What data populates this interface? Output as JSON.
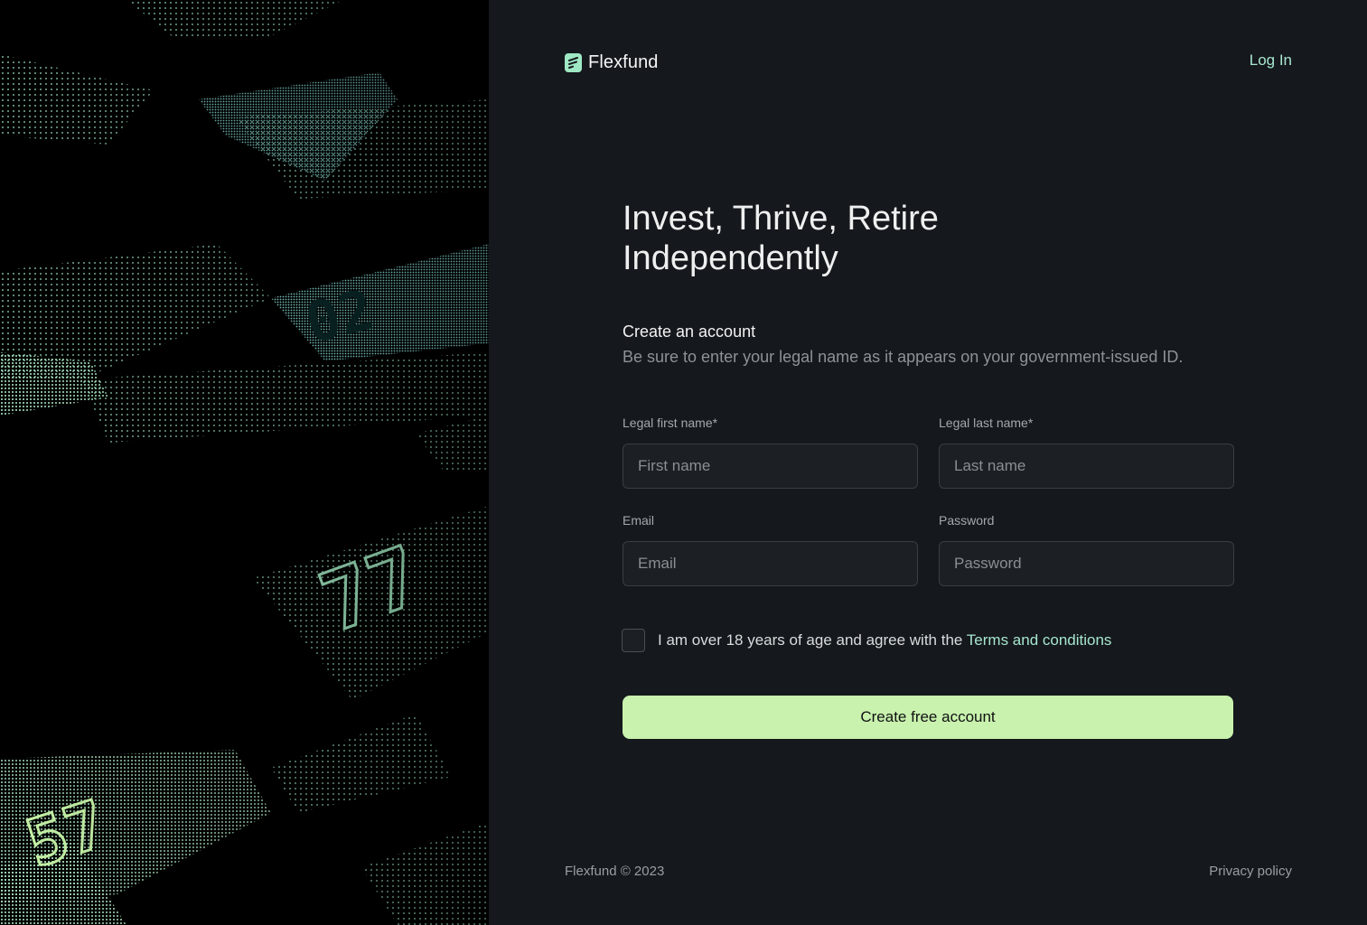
{
  "brand": {
    "name": "Flexfund",
    "accent": "#a6e6cf",
    "button_color": "#c8f2ae",
    "icon": "flexfund-logo-icon"
  },
  "nav": {
    "login_label": "Log In"
  },
  "hero": {
    "headline_line1": "Invest, Thrive, Retire",
    "headline_line2": "Independently"
  },
  "form": {
    "title": "Create an account",
    "subtitle": "Be sure to enter your legal name as it appears on your government-issued ID.",
    "first_name": {
      "label": "Legal first name*",
      "placeholder": "First name",
      "value": ""
    },
    "last_name": {
      "label": "Legal last name*",
      "placeholder": "Last name",
      "value": ""
    },
    "email": {
      "label": "Email",
      "placeholder": "Email",
      "value": ""
    },
    "password": {
      "label": "Password",
      "placeholder": "Password",
      "value": ""
    },
    "terms_text": "I am over 18 years of age and agree with the ",
    "terms_link": "Terms and conditions",
    "terms_checked": false,
    "submit_label": "Create free account"
  },
  "footer": {
    "copyright": "Flexfund © 2023",
    "privacy_label": "Privacy policy"
  },
  "art": {
    "digits": [
      "02",
      "77",
      "57"
    ],
    "colors": [
      "#7fe3dc",
      "#a6eec6",
      "#c8f5a8"
    ]
  }
}
